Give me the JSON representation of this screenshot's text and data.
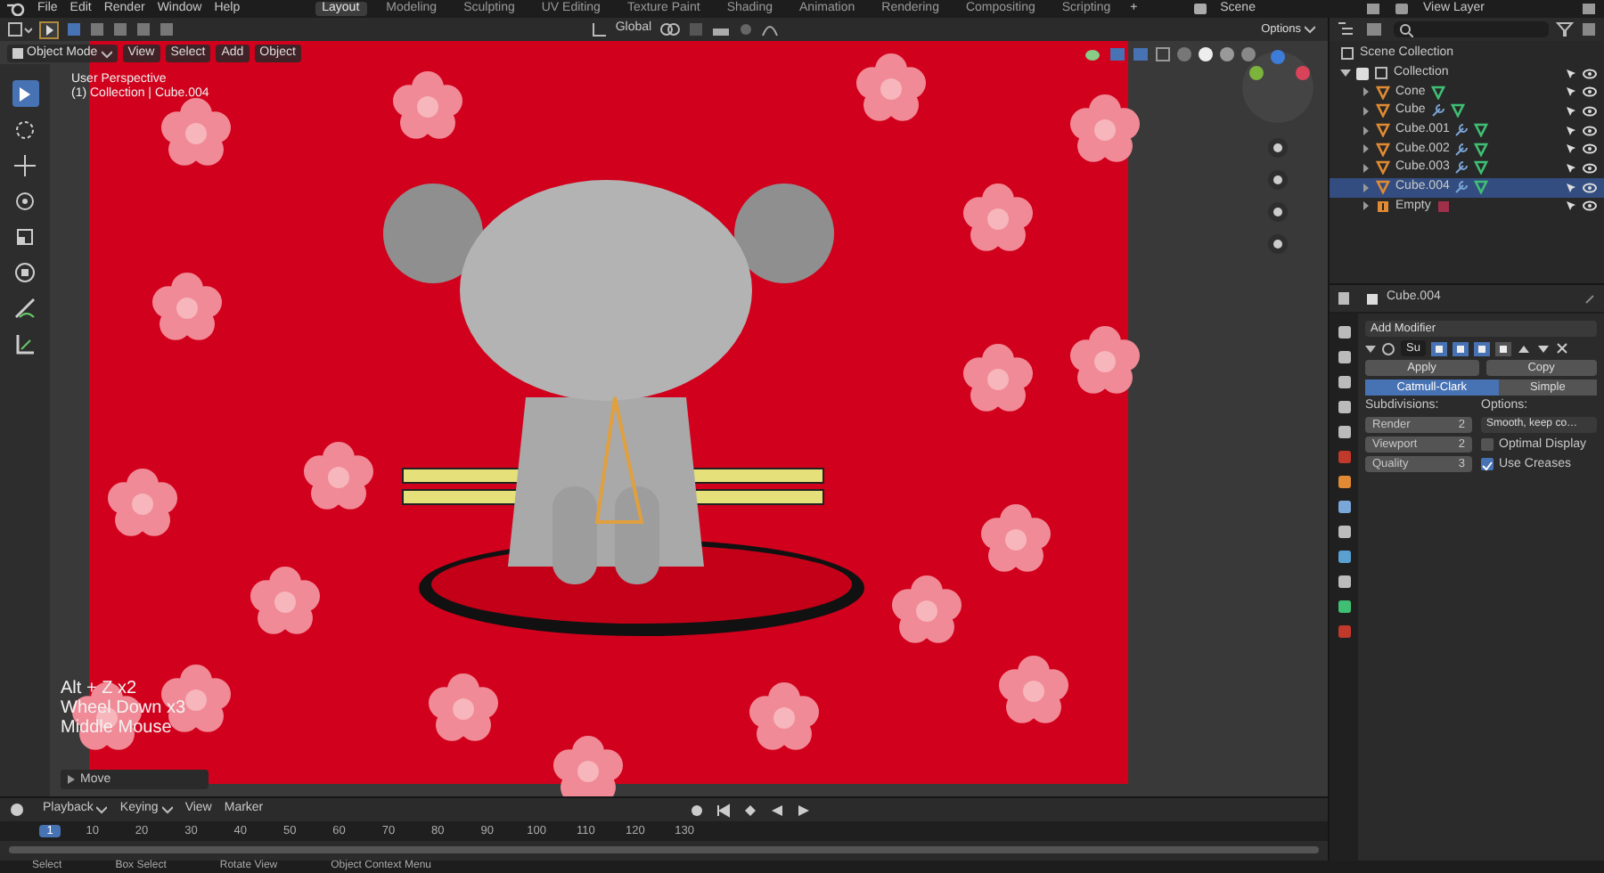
{
  "menu_bar": {
    "menus": [
      "File",
      "Edit",
      "Render",
      "Window",
      "Help"
    ],
    "workspace_tabs": [
      {
        "label": "Layout",
        "selected": true
      },
      {
        "label": "Modeling",
        "selected": false
      },
      {
        "label": "Sculpting",
        "selected": false
      },
      {
        "label": "UV Editing",
        "selected": false
      },
      {
        "label": "Texture Paint",
        "selected": false
      },
      {
        "label": "Shading",
        "selected": false
      },
      {
        "label": "Animation",
        "selected": false
      },
      {
        "label": "Rendering",
        "selected": false
      },
      {
        "label": "Compositing",
        "selected": false
      },
      {
        "label": "Scripting",
        "selected": false
      }
    ],
    "add_tab": "+",
    "scene": "Scene",
    "view_layer": "View Layer"
  },
  "tool_header": {
    "orientation": "Global",
    "options": "Options"
  },
  "viewport": {
    "mode": "Object Mode",
    "menus": [
      "View",
      "Select",
      "Add",
      "Object"
    ],
    "view_name": "User Perspective",
    "context": "(1) Collection | Cube.004",
    "tools": [
      {
        "kind": "select",
        "selected": true
      },
      {
        "kind": "cursor",
        "selected": false
      },
      {
        "kind": "move",
        "selected": false
      },
      {
        "kind": "rotate",
        "selected": false
      },
      {
        "kind": "scale",
        "selected": false
      },
      {
        "kind": "transform",
        "selected": false
      },
      {
        "kind": "annotate",
        "selected": false
      },
      {
        "kind": "measure",
        "selected": false
      }
    ],
    "keystrokes": [
      "Alt + Z x2",
      "Wheel Down x3",
      "Middle Mouse"
    ],
    "last_operator": "Move"
  },
  "outliner": {
    "root": "Scene Collection",
    "collection": {
      "label": "Collection",
      "checked": true,
      "expanded": true,
      "children": [
        {
          "label": "Cone",
          "kind": "mesh",
          "has_modifier": false,
          "selected": false
        },
        {
          "label": "Cube",
          "kind": "mesh",
          "has_modifier": true,
          "selected": false
        },
        {
          "label": "Cube.001",
          "kind": "mesh",
          "has_modifier": true,
          "selected": false
        },
        {
          "label": "Cube.002",
          "kind": "mesh",
          "has_modifier": true,
          "selected": false
        },
        {
          "label": "Cube.003",
          "kind": "mesh",
          "has_modifier": true,
          "selected": false
        },
        {
          "label": "Cube.004",
          "kind": "mesh",
          "has_modifier": true,
          "selected": true
        },
        {
          "label": "Empty",
          "kind": "empty",
          "has_modifier": false,
          "selected": false
        }
      ]
    }
  },
  "properties": {
    "object": "Cube.004",
    "add_modifier": "Add Modifier",
    "modifier_name": "Su",
    "apply": "Apply",
    "copy": "Copy",
    "types": [
      {
        "label": "Catmull-Clark",
        "selected": true
      },
      {
        "label": "Simple",
        "selected": false
      }
    ],
    "subdivisions_label": "Subdivisions:",
    "fields": [
      {
        "label": "Render",
        "value": "2"
      },
      {
        "label": "Viewport",
        "value": "2"
      },
      {
        "label": "Quality",
        "value": "3"
      }
    ],
    "options_label": "Options:",
    "uv_smooth": "Smooth, keep co…",
    "checkboxes": [
      {
        "label": "Optimal Display",
        "checked": false
      },
      {
        "label": "Use Creases",
        "checked": true
      }
    ]
  },
  "timeline": {
    "menus": [
      {
        "label": "Playback",
        "dropdown": true
      },
      {
        "label": "Keying",
        "dropdown": true
      },
      {
        "label": "View",
        "dropdown": false
      },
      {
        "label": "Marker",
        "dropdown": false
      }
    ],
    "current_frame": "1",
    "ticks": [
      "10",
      "20",
      "30",
      "40",
      "50",
      "60",
      "70",
      "80",
      "90",
      "100",
      "110",
      "120",
      "130"
    ]
  },
  "status_bar": {
    "items": [
      "Select",
      "Box Select",
      "Rotate View",
      "Object Context Menu"
    ]
  }
}
